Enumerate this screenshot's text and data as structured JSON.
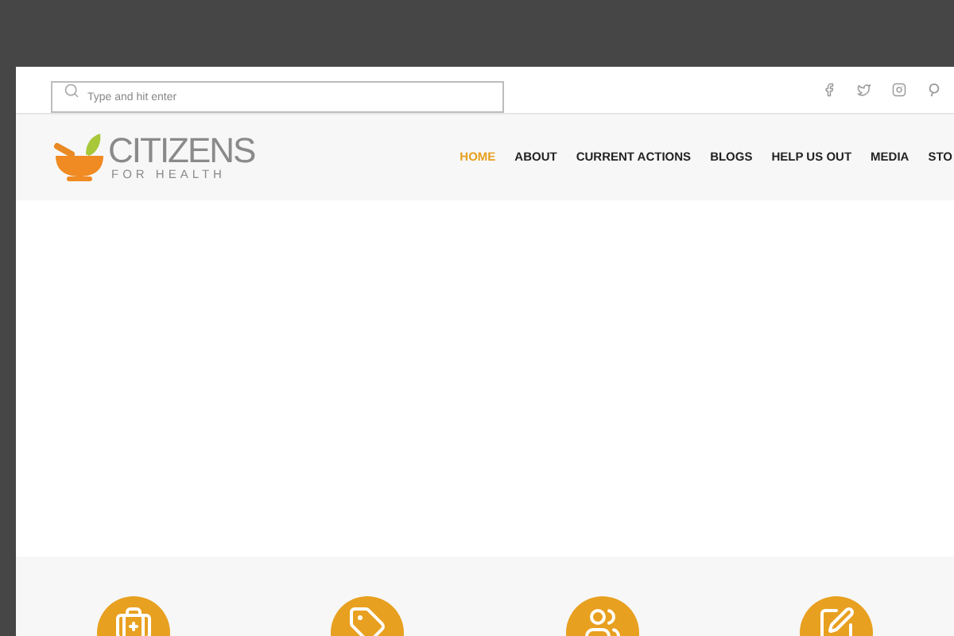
{
  "search": {
    "placeholder": "Type and hit enter"
  },
  "logo": {
    "title": "CITIZENS",
    "subtitle": "FOR HEALTH"
  },
  "nav": [
    {
      "label": "HOME",
      "selected": true
    },
    {
      "label": "ABOUT",
      "selected": false
    },
    {
      "label": "CURRENT ACTIONS",
      "selected": false
    },
    {
      "label": "BLOGS",
      "selected": false
    },
    {
      "label": "HELP US OUT",
      "selected": false
    },
    {
      "label": "MEDIA",
      "selected": false
    },
    {
      "label": "STO",
      "selected": false
    }
  ],
  "features": [
    {
      "kind": "kit"
    },
    {
      "kind": "tag"
    },
    {
      "kind": "people"
    },
    {
      "kind": "edit"
    }
  ]
}
